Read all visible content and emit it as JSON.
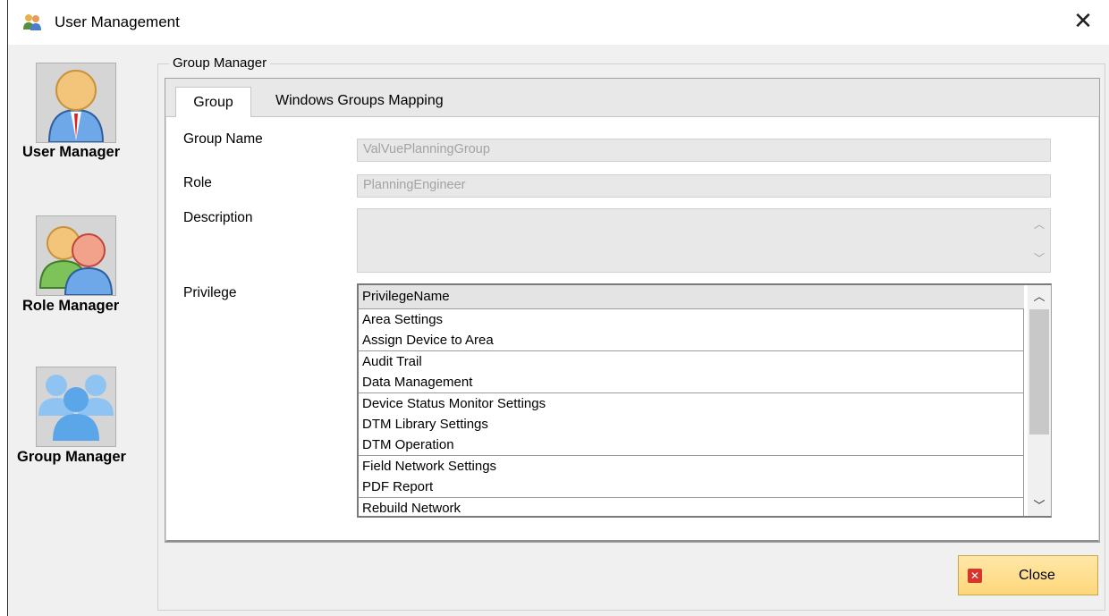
{
  "window": {
    "title": "User Management"
  },
  "nav": [
    {
      "label": "User Manager",
      "icon": "user-icon"
    },
    {
      "label": "Role Manager",
      "icon": "role-icon"
    },
    {
      "label": "Group Manager",
      "icon": "group-icon"
    }
  ],
  "group_manager": {
    "legend": "Group Manager",
    "tabs": [
      {
        "label": "Group"
      },
      {
        "label": "Windows Groups Mapping"
      }
    ],
    "fields": {
      "group_name": {
        "label": "Group Name",
        "value": "ValVuePlanningGroup"
      },
      "role": {
        "label": "Role",
        "value": "PlanningEngineer"
      },
      "description": {
        "label": "Description",
        "value": ""
      },
      "privilege": {
        "label": "Privilege"
      }
    },
    "grid": {
      "header": "PrivilegeName",
      "rows": [
        "Area Settings",
        "Assign Device to Area",
        "Audit Trail",
        "Data Management",
        "Device Status Monitor Settings",
        "DTM Library Settings",
        "DTM Operation",
        "Field Network Settings",
        "PDF Report",
        "Rebuild Network"
      ]
    }
  },
  "buttons": {
    "close": "Close"
  },
  "colors": {
    "close_button": "#fdd77a",
    "close_icon": "#d9362b",
    "field_bg": "#e8e8e8"
  }
}
